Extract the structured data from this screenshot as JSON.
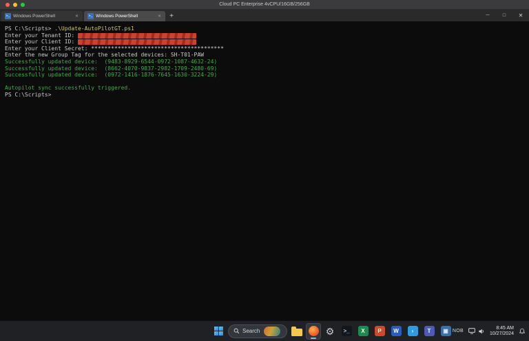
{
  "macos_bar": {
    "title": "Cloud PC Enterprise 4vCPU/16GB/256GB"
  },
  "terminal_window": {
    "tabs": [
      {
        "label": "Windows PowerShell",
        "close_glyph": "✕"
      },
      {
        "label": "Windows PowerShell",
        "close_glyph": "✕"
      }
    ],
    "tab_icon_glyph": ">_",
    "new_tab_glyph": "+",
    "controls": {
      "minimize": "─",
      "maximize": "□",
      "close": "✕"
    }
  },
  "terminal": {
    "colors": {
      "default": "#cccccc",
      "yellow": "#d3c66a",
      "green": "#3fae4a"
    },
    "lines": [
      {
        "segments": [
          {
            "text": "PS C:\\Scripts> ",
            "color": "default"
          },
          {
            "text": ".\\Update-AutoPilotGT.ps1",
            "color": "yellow"
          }
        ]
      },
      {
        "segments": [
          {
            "text": "Enter your Tenant ID: ",
            "color": "default"
          },
          {
            "redacted": true
          }
        ]
      },
      {
        "segments": [
          {
            "text": "Enter your Client ID: ",
            "color": "default"
          },
          {
            "redacted": true
          }
        ]
      },
      {
        "segments": [
          {
            "text": "Enter your Client Secret: ****************************************",
            "color": "default"
          }
        ]
      },
      {
        "segments": [
          {
            "text": "Enter the new Group Tag for the selected devices: SH-T01-PAW",
            "color": "default"
          }
        ]
      },
      {
        "segments": [
          {
            "text": "Successfully updated device:  (9483-8929-6544-0972-1087-4632-24)",
            "color": "green"
          }
        ]
      },
      {
        "segments": [
          {
            "text": "Successfully updated device:  (8662-4070-9837-2982-1709-2480-69)",
            "color": "green"
          }
        ]
      },
      {
        "segments": [
          {
            "text": "Successfully updated device:  (0972-1416-1876-7645-1630-3224-29)",
            "color": "green"
          }
        ]
      },
      {
        "segments": []
      },
      {
        "segments": [
          {
            "text": "Autopilot sync successfully triggered.",
            "color": "green"
          }
        ]
      },
      {
        "segments": [
          {
            "text": "PS C:\\Scripts>",
            "color": "default"
          }
        ]
      }
    ]
  },
  "taskbar": {
    "search": {
      "placeholder": "Search"
    },
    "icons": [
      {
        "name": "file-explorer-icon",
        "shape": "folder",
        "bg": "#f3c94b"
      },
      {
        "name": "browser-icon",
        "shape": "circle",
        "bg": "radial-gradient(circle at 38% 35%, #ffb347 0%, #f4642c 55%, #d43a26 100%)",
        "active": true
      },
      {
        "name": "settings-gear-icon",
        "shape": "glyph",
        "glyph": "⚙",
        "fg": "#c8ccd2"
      },
      {
        "name": "terminal-icon",
        "shape": "square",
        "glyph": ">_",
        "bg": "#14161a",
        "fg": "#9ad1ff"
      },
      {
        "name": "excel-icon",
        "shape": "square",
        "glyph": "X",
        "bg": "#1d8a4e",
        "fg": "#ffffff"
      },
      {
        "name": "powerpoint-icon",
        "shape": "square",
        "glyph": "P",
        "bg": "#cf4a2c",
        "fg": "#ffffff"
      },
      {
        "name": "word-icon",
        "shape": "square",
        "glyph": "W",
        "bg": "#2a5bbf",
        "fg": "#ffffff"
      },
      {
        "name": "vscode-icon",
        "shape": "square",
        "glyph": "›",
        "bg": "#2f9be0",
        "fg": "#ffffff"
      },
      {
        "name": "teams-icon",
        "shape": "square",
        "glyph": "T",
        "bg": "#4d5bb5",
        "fg": "#ffffff"
      },
      {
        "name": "remote-desktop-icon",
        "shape": "square",
        "glyph": "▣",
        "bg": "#3a6fa8",
        "fg": "#dce9f7"
      }
    ],
    "tray": {
      "chevron": "^",
      "language": "NOB",
      "time": "8:45 AM",
      "date": "10/27/2024"
    }
  }
}
